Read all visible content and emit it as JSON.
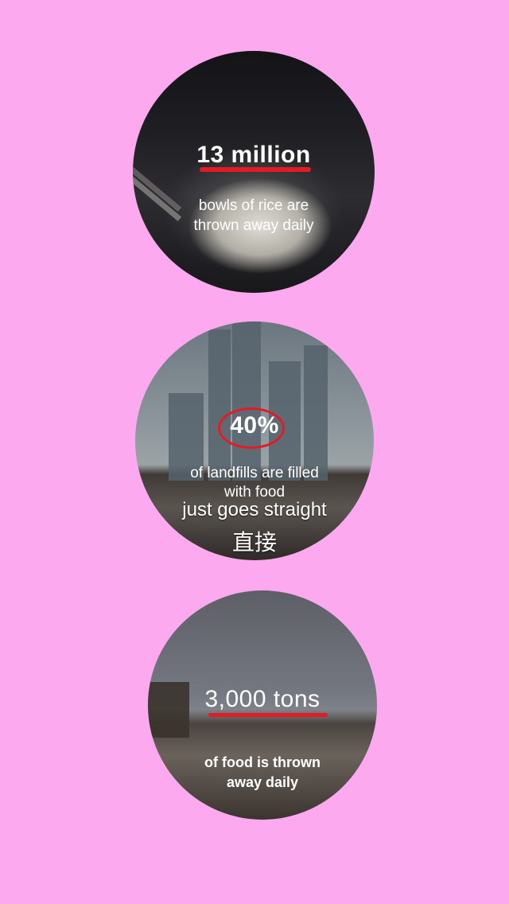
{
  "stats": [
    {
      "headline": "13 million",
      "caption_line1": "bowls of rice are",
      "caption_line2": "thrown away daily",
      "image": "rice-bowl-photo"
    },
    {
      "headline": "40%",
      "caption_line1": "of landfills are filled",
      "caption_line2": "with food",
      "image": "city-landfill-photo"
    },
    {
      "headline": "3,000 tons",
      "caption_line1": "of food is thrown",
      "caption_line2": "away daily",
      "image": "landfill-bulldozer-photo"
    }
  ],
  "subtitles": {
    "english": "just goes straight",
    "chinese": "直接"
  },
  "colors": {
    "background": "#fda9f0",
    "accent": "#e11c24",
    "text": "#ffffff"
  }
}
